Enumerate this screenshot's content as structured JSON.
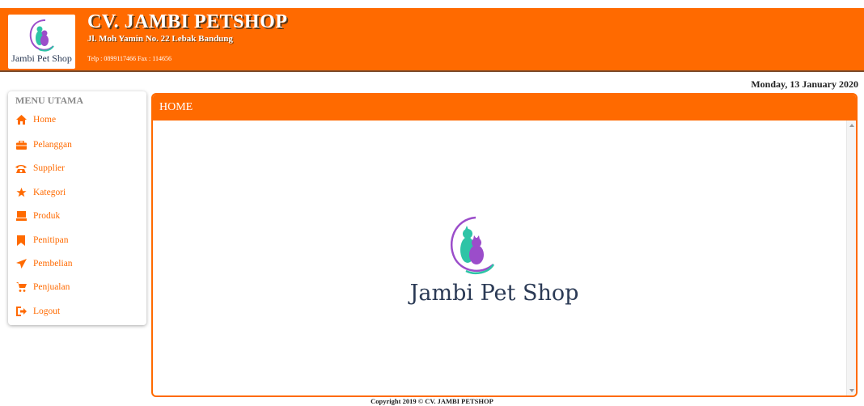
{
  "header": {
    "logo_text": "Jambi Pet Shop",
    "company_name": "CV. JAMBI PETSHOP",
    "address": "Jl. Moh Yamin No. 22 Lebak Bandung",
    "contact": "Telp : 0899117466 Fax : 114656"
  },
  "date": "Monday, 13 January 2020",
  "sidebar": {
    "title": "MENU UTAMA",
    "items": [
      {
        "label": "Home",
        "icon": "home-icon"
      },
      {
        "label": "Pelanggan",
        "icon": "briefcase-icon"
      },
      {
        "label": "Supplier",
        "icon": "phone-icon"
      },
      {
        "label": "Kategori",
        "icon": "star-icon"
      },
      {
        "label": "Produk",
        "icon": "box-icon"
      },
      {
        "label": "Penitipan",
        "icon": "bookmark-icon"
      },
      {
        "label": "Pembelian",
        "icon": "plane-icon"
      },
      {
        "label": "Penjualan",
        "icon": "cart-icon"
      },
      {
        "label": "Logout",
        "icon": "logout-icon"
      }
    ]
  },
  "main": {
    "title": "HOME",
    "logo_text": "Jambi Pet Shop"
  },
  "footer": "Copyright 2019 © CV. JAMBI PETSHOP",
  "colors": {
    "accent": "#ff6a00",
    "logo_teal": "#2ec4a6",
    "logo_purple": "#9b4dca",
    "logo_text": "#2b3a55"
  }
}
